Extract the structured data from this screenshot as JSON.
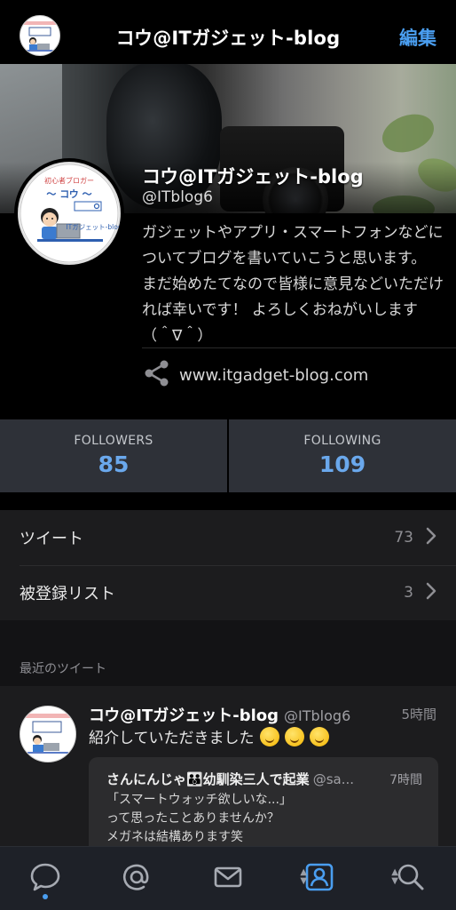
{
  "header": {
    "title": "コウ@ITガジェット-blog",
    "edit_label": "編集"
  },
  "profile": {
    "name": "コウ@ITガジェット-blog",
    "handle": "@ITblog6",
    "bio": "ガジェットやアプリ・スマートフォンなどについてブログを書いていこうと思います。 まだ始めたてなので皆様に意見などいただければ幸いです！ よろしくおねがいします（＾∇＾）",
    "website": "www.itgadget-blog.com",
    "avatar_text": {
      "line1": "初心者ブロガー",
      "line2": "〜 コウ 〜",
      "line3": "ITガジェット-blog"
    }
  },
  "stats": {
    "followers_label": "FOLLOWERS",
    "followers_count": "85",
    "following_label": "FOLLOWING",
    "following_count": "109"
  },
  "list": {
    "items": [
      {
        "label": "ツイート",
        "count": "73"
      },
      {
        "label": "被登録リスト",
        "count": "3"
      }
    ]
  },
  "recent": {
    "section_title": "最近のツイート",
    "tweet": {
      "name": "コウ@ITガジェット-blog",
      "handle": "@ITblog6",
      "time": "5時間",
      "text": "紹介していただきました",
      "quote": {
        "name": "さんにんじゃ👪幼馴染三人で起業",
        "handle": "@sa...",
        "time": "7時間",
        "body": "「スマートウォッチ欲しいな...」\nって思ったことありませんか？\nメガネは結構あります笑"
      }
    }
  },
  "tabs": [
    "timeline-tab",
    "mentions-tab",
    "messages-tab",
    "profile-tab",
    "search-tab"
  ],
  "colors": {
    "accent": "#4a9ef0",
    "stat_number": "#6aa8ec",
    "stats_bg": "#2e3138",
    "tabbar_bg": "#1e2128"
  }
}
